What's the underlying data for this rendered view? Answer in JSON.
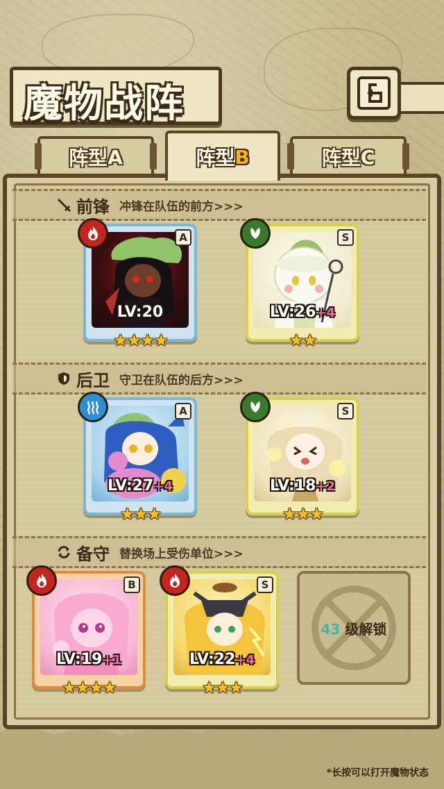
{
  "header": {
    "title": "魔物战阵",
    "back_icon": "back-arrow-icon"
  },
  "tabs": [
    {
      "prefix": "阵型",
      "suffix": "A",
      "active": false
    },
    {
      "prefix": "阵型",
      "suffix": "B",
      "active": true
    },
    {
      "prefix": "阵型",
      "suffix": "C",
      "active": false
    }
  ],
  "sections": {
    "vanguard": {
      "icon": "sword-icon",
      "title": "前锋",
      "desc": "冲锋在队伍的前方>>>"
    },
    "rearguard": {
      "icon": "shield-icon",
      "title": "后卫",
      "desc": "守卫在队伍的后方>>>"
    },
    "reserve": {
      "icon": "swap-icon",
      "title": "备守",
      "desc": "替换场上受伤单位>>>"
    }
  },
  "cards": {
    "v1": {
      "element": "fire",
      "rank": "A",
      "level": "LV:20",
      "bonus": "",
      "stars": "★★★★",
      "star_count": 4,
      "border": "#7ab7d6"
    },
    "v2": {
      "element": "wood",
      "rank": "S",
      "level": "LV:26",
      "bonus": "+4",
      "stars": "★★",
      "star_count": 2,
      "border": "#d8cf4a"
    },
    "r1": {
      "element": "water",
      "rank": "A",
      "level": "LV:27",
      "bonus": "+4",
      "stars": "★★★",
      "star_count": 3,
      "border": "#7ab7d6"
    },
    "r2": {
      "element": "wood",
      "rank": "S",
      "level": "LV:18",
      "bonus": "+2",
      "stars": "★★★",
      "star_count": 3,
      "border": "#d8cf4a"
    },
    "b1": {
      "element": "fire",
      "rank": "B",
      "level": "LV:19",
      "bonus": "+1",
      "stars": "★★★★",
      "star_count": 4,
      "border": "#e08a3c"
    },
    "b2": {
      "element": "fire",
      "rank": "S",
      "level": "LV:22",
      "bonus": "+4",
      "stars": "★★★",
      "star_count": 3,
      "border": "#d8cf4a"
    }
  },
  "locked_slot": {
    "level": "43",
    "label": "级解锁"
  },
  "hint": "*长按可以打开魔物状态"
}
